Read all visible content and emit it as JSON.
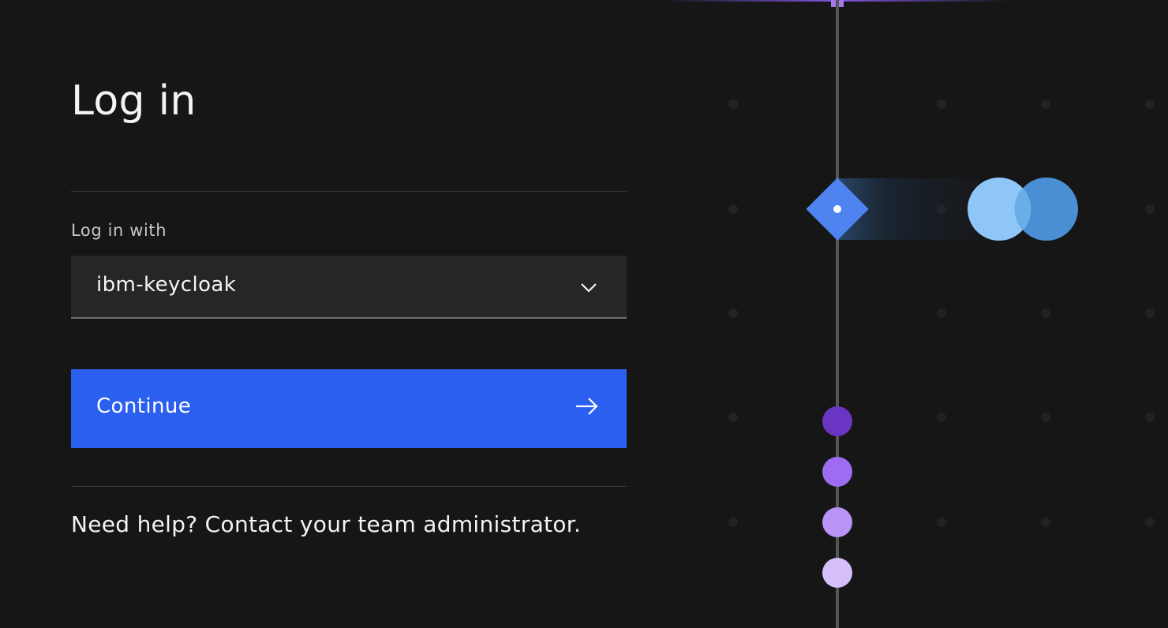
{
  "page": {
    "title": "Log in"
  },
  "login": {
    "select_label": "Log in with",
    "select_value": "ibm-keycloak",
    "continue_label": "Continue",
    "help_text": "Need help? Contact your team administrator."
  },
  "colors": {
    "background": "#161616",
    "button": "#2b5fef",
    "field": "#262626",
    "text": "#f4f4f4",
    "label": "#c6c6c6"
  },
  "icons": {
    "select": "chevron-down-icon",
    "button": "arrow-right-icon"
  }
}
